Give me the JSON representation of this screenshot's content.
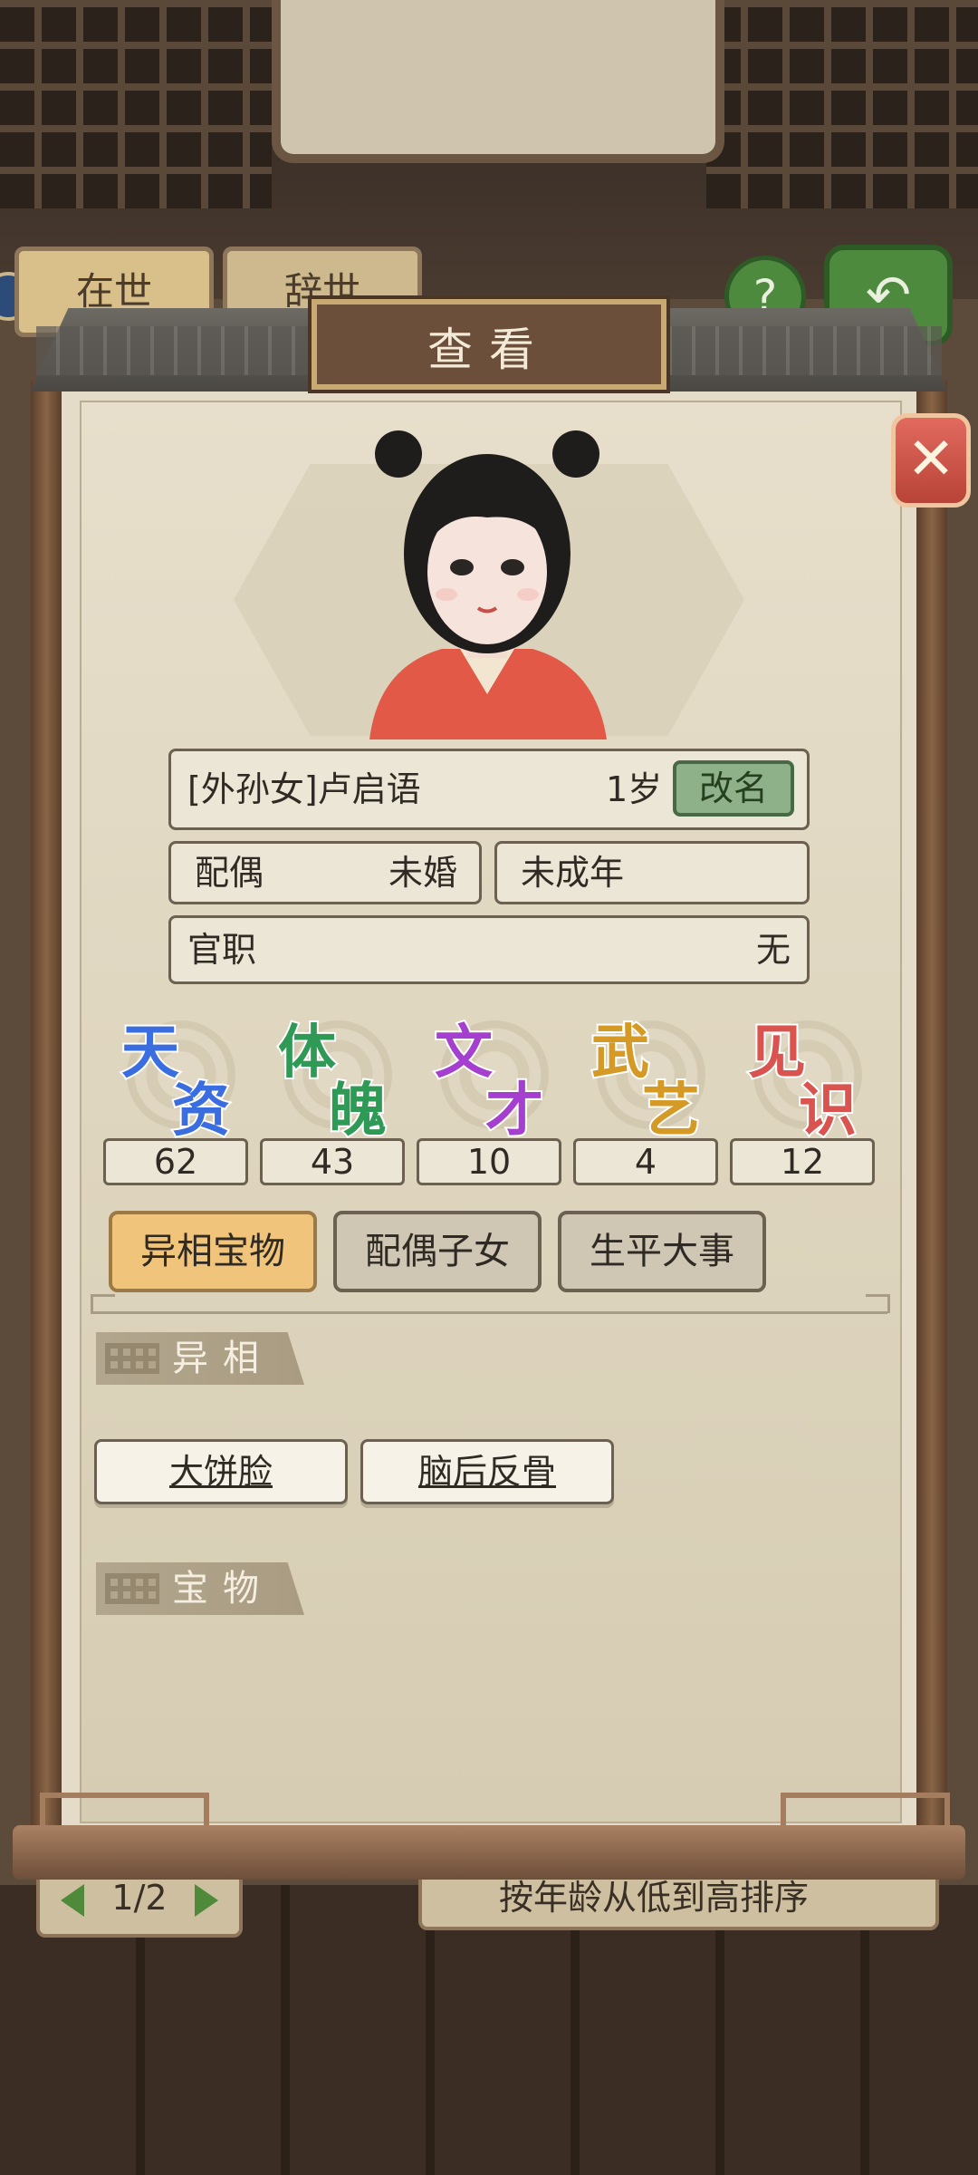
{
  "background": {
    "tabs": [
      "在世",
      "辞世"
    ],
    "help_icon": "question-mark-icon",
    "return_icon": "return-arrow-icon",
    "pagination": "1/2",
    "sort_label": "按年龄从低到高排序"
  },
  "dialog": {
    "title": "查看",
    "close_icon": "close-x-icon"
  },
  "profile": {
    "name": "[外孙女]卢启语",
    "age": "1岁",
    "rename_button": "改名",
    "spouse_label": "配偶",
    "spouse_value": "未婚",
    "adult_status": "未成年",
    "office_label": "官职",
    "office_value": "无"
  },
  "attributes": [
    {
      "chars": [
        "天",
        "资"
      ],
      "value": "62",
      "color": "#3a6ee0"
    },
    {
      "chars": [
        "体",
        "魄"
      ],
      "value": "43",
      "color": "#2f9a55"
    },
    {
      "chars": [
        "文",
        "才"
      ],
      "value": "10",
      "color": "#a53fd0"
    },
    {
      "chars": [
        "武",
        "艺"
      ],
      "value": "4",
      "color": "#d49a25"
    },
    {
      "chars": [
        "见",
        "识"
      ],
      "value": "12",
      "color": "#d9534f"
    }
  ],
  "tabs": [
    {
      "label": "异相宝物",
      "active": true
    },
    {
      "label": "配偶子女",
      "active": false
    },
    {
      "label": "生平大事",
      "active": false
    }
  ],
  "sections": {
    "traits_title": "异相",
    "traits": [
      "大饼脸",
      "脑后反骨"
    ],
    "treasures_title": "宝物"
  }
}
